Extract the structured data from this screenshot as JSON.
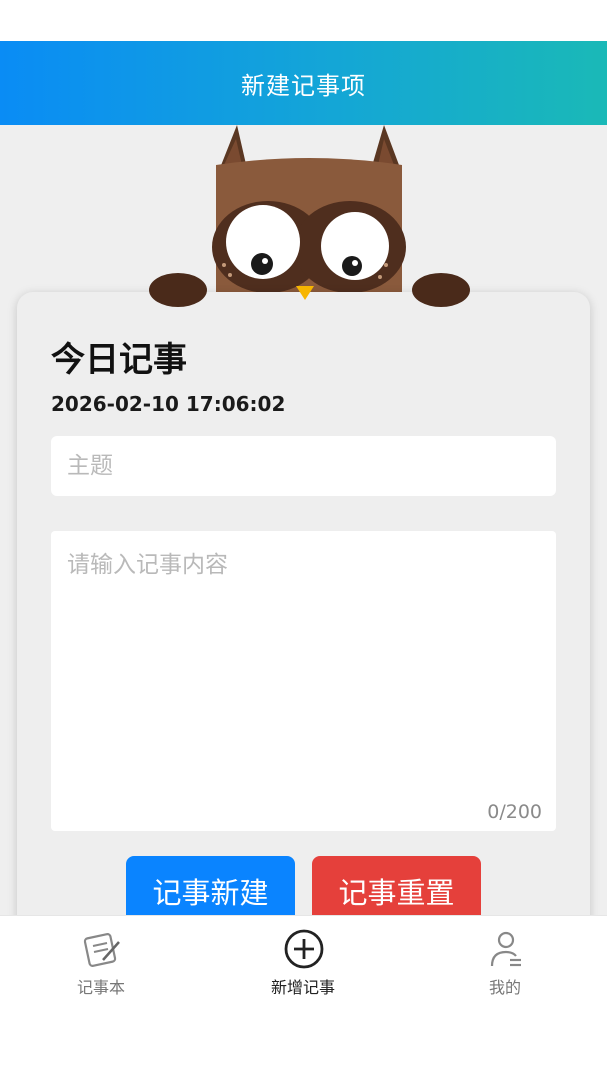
{
  "header": {
    "title": "新建记事项"
  },
  "card": {
    "title": "今日记事",
    "datetime": "2026-02-10 17:06:02",
    "subject_placeholder": "主题",
    "subject_value": "",
    "content_placeholder": "请输入记事内容",
    "content_value": "",
    "char_count": "0/200"
  },
  "buttons": {
    "create_label": "记事新建",
    "reset_label": "记事重置"
  },
  "tabs": [
    {
      "label": "记事本",
      "icon": "notebook-icon",
      "active": false
    },
    {
      "label": "新增记事",
      "icon": "add-circle-icon",
      "active": true
    },
    {
      "label": "我的",
      "icon": "user-icon",
      "active": false
    }
  ],
  "colors": {
    "header_gradient_start": "#0a8cf5",
    "header_gradient_end": "#1ab9b7",
    "create_button": "#0a84ff",
    "reset_button": "#e5403b",
    "owl_brown": "#8a5a3c"
  }
}
